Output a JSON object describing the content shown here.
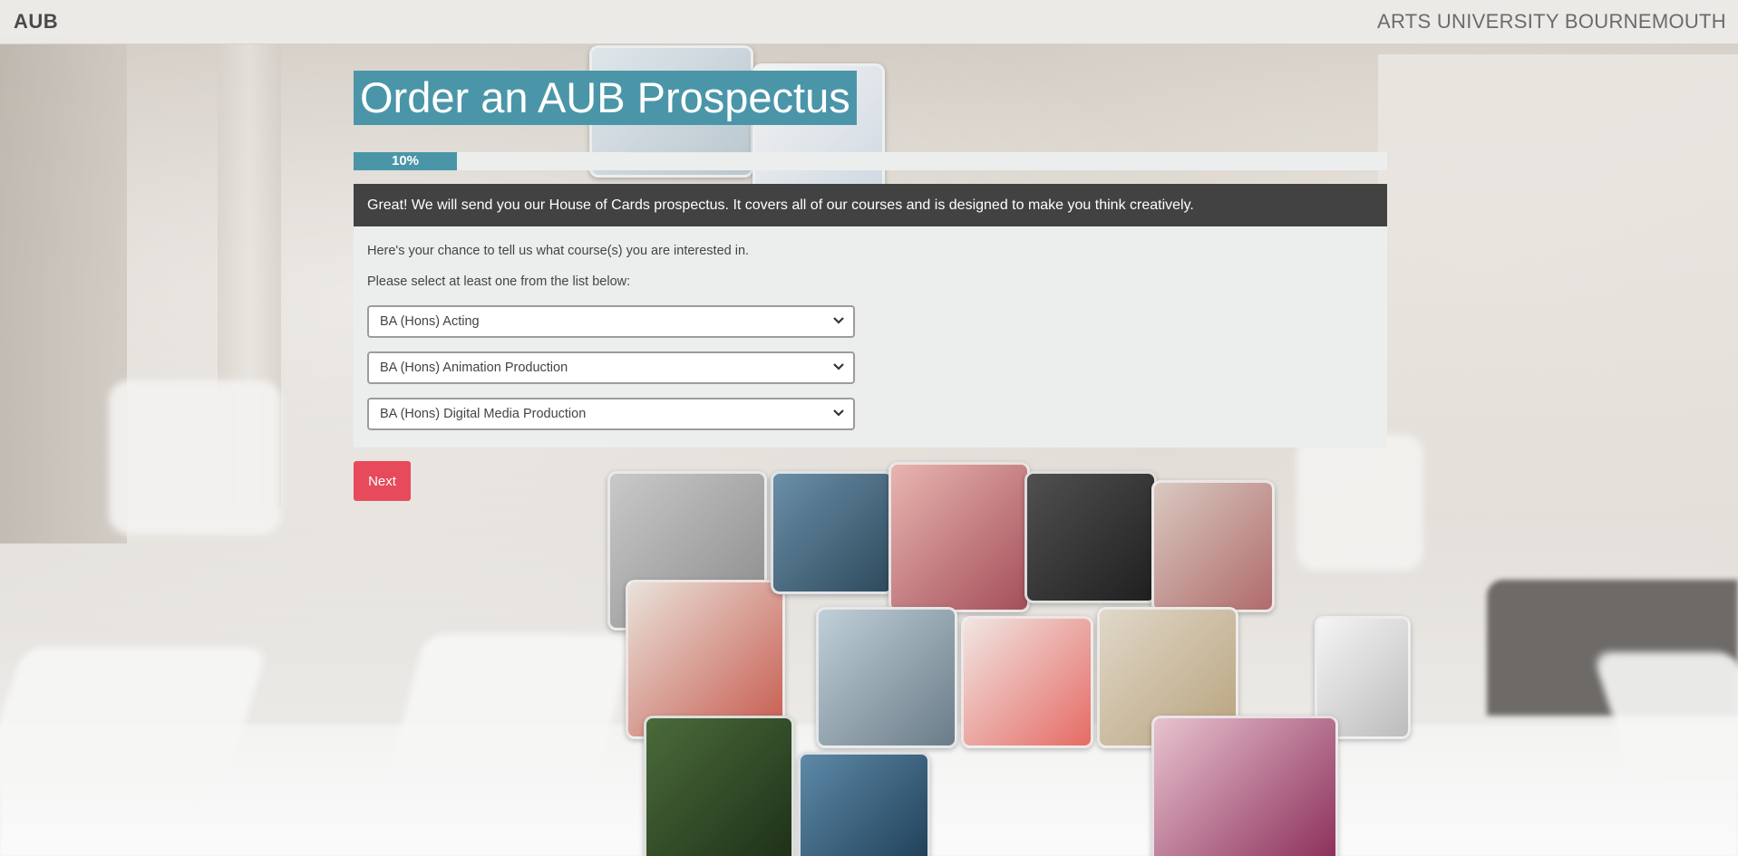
{
  "header": {
    "brand": "AUB",
    "institution": "ARTS UNIVERSITY BOURNEMOUTH"
  },
  "form": {
    "title": "Order an AUB Prospectus",
    "progress": {
      "label": "10%",
      "fraction": 0.1
    },
    "panel_heading": "Great! We will send you our House of Cards prospectus. It covers all of our courses and is designed to make you think creatively.",
    "intro_text": "Here's your chance to tell us what course(s) you are interested in.",
    "instruction_text": "Please select at least one from the list below:",
    "course_selects": [
      {
        "selected": "BA (Hons) Acting"
      },
      {
        "selected": "BA (Hons) Animation Production"
      },
      {
        "selected": "BA (Hons) Digital Media Production"
      }
    ],
    "next_label": "Next"
  },
  "colors": {
    "accent_teal": "#4a96a8",
    "panel_dark": "#424242",
    "panel_light": "#eceeee",
    "button_red": "#e74a5b"
  },
  "icons": {
    "select_arrow": "chevron-down-icon"
  }
}
